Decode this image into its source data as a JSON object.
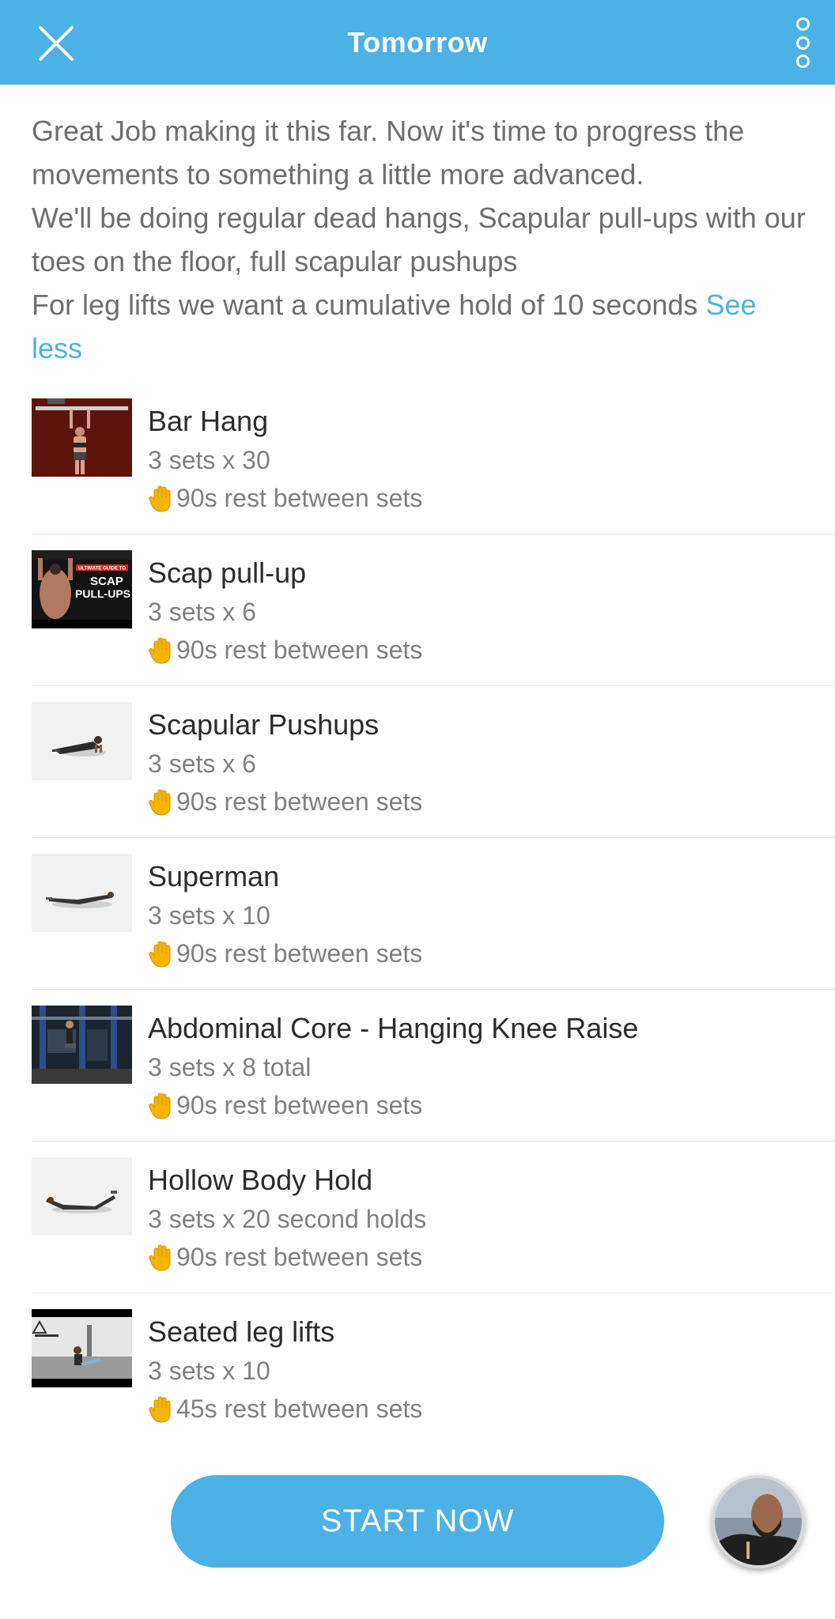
{
  "header": {
    "title": "Tomorrow",
    "close_icon": "close-icon",
    "menu_icon": "more-vertical-icon",
    "color": "#4cb1e4"
  },
  "description": {
    "line1": "Great Job making it this far. Now it's time to progress the movements to something a little more advanced.",
    "line2": "We'll be doing regular dead hangs, Scapular pull-ups with our toes on the floor, full scapular pushups",
    "line3": "For leg lifts we want a cumulative hold of 10 seconds",
    "see_less": "See less"
  },
  "exercises": [
    {
      "name": "Bar Hang",
      "sets": "3 sets x 30",
      "rest": "90s rest between sets"
    },
    {
      "name": "Scap pull-up",
      "sets": "3 sets x 6",
      "rest": "90s rest between sets",
      "thumb_text": [
        "ULTIMATE GUIDE TO",
        "SCAP",
        "PULL-UPS"
      ]
    },
    {
      "name": "Scapular Pushups",
      "sets": "3 sets x 6",
      "rest": "90s rest between sets"
    },
    {
      "name": "Superman",
      "sets": "3 sets x 10",
      "rest": "90s rest between sets"
    },
    {
      "name": "Abdominal Core - Hanging Knee Raise",
      "sets": "3 sets x 8 total",
      "rest": "90s rest between sets"
    },
    {
      "name": "Hollow Body Hold",
      "sets": "3 sets x 20 second holds",
      "rest": "90s rest between sets"
    },
    {
      "name": "Seated leg lifts",
      "sets": "3 sets x 10",
      "rest": "45s rest between sets"
    }
  ],
  "footer": {
    "start_label": "START NOW",
    "avatar_icon": "coach-avatar"
  }
}
